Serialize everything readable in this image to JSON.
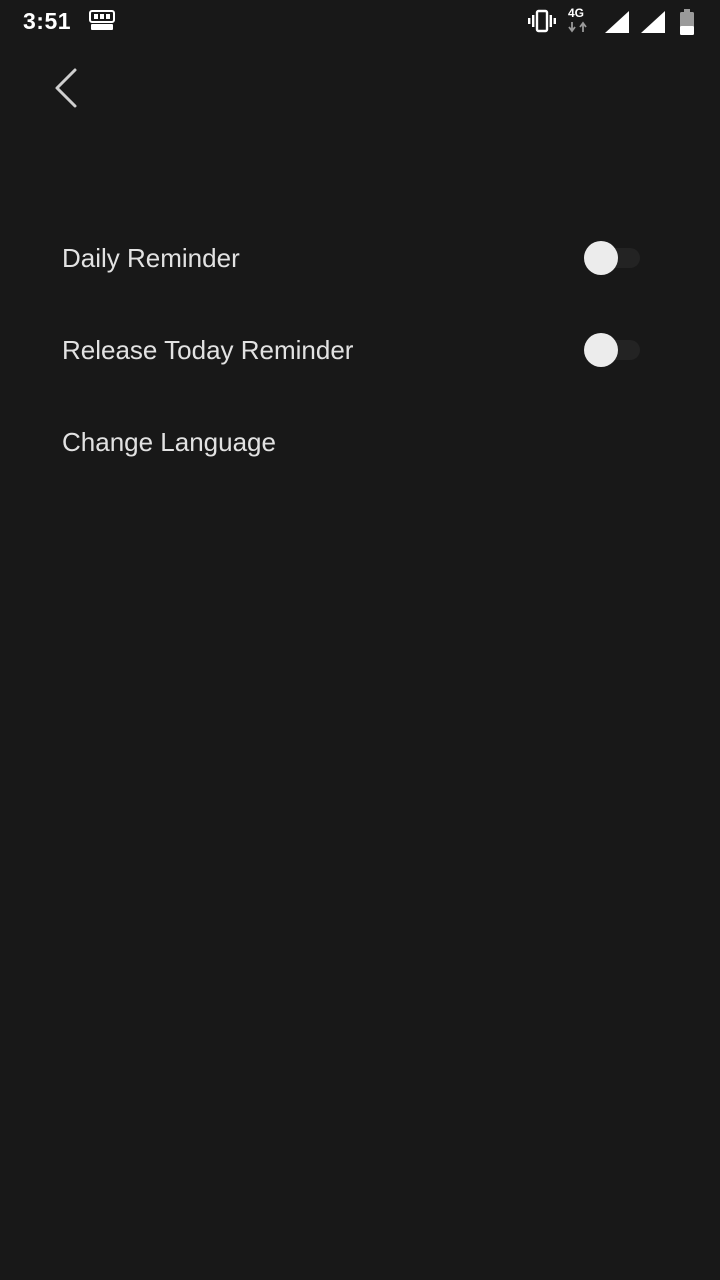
{
  "status_bar": {
    "time": "3:51",
    "app_notification_icon": "toy-blast-icon",
    "vibrate_icon": "vibrate-icon",
    "network_type": "4G",
    "signal_icons": [
      "signal-icon",
      "signal-icon"
    ],
    "battery_icon": "battery-icon"
  },
  "header": {
    "back_icon": "chevron-left-icon"
  },
  "settings": {
    "items": [
      {
        "label": "Daily Reminder",
        "toggle": false
      },
      {
        "label": "Release Today Reminder",
        "toggle": false
      },
      {
        "label": "Change Language"
      }
    ]
  },
  "colors": {
    "background": "#181818",
    "text": "#e2e2e2",
    "toggle_thumb": "#ececec",
    "toggle_track": "#232323"
  }
}
